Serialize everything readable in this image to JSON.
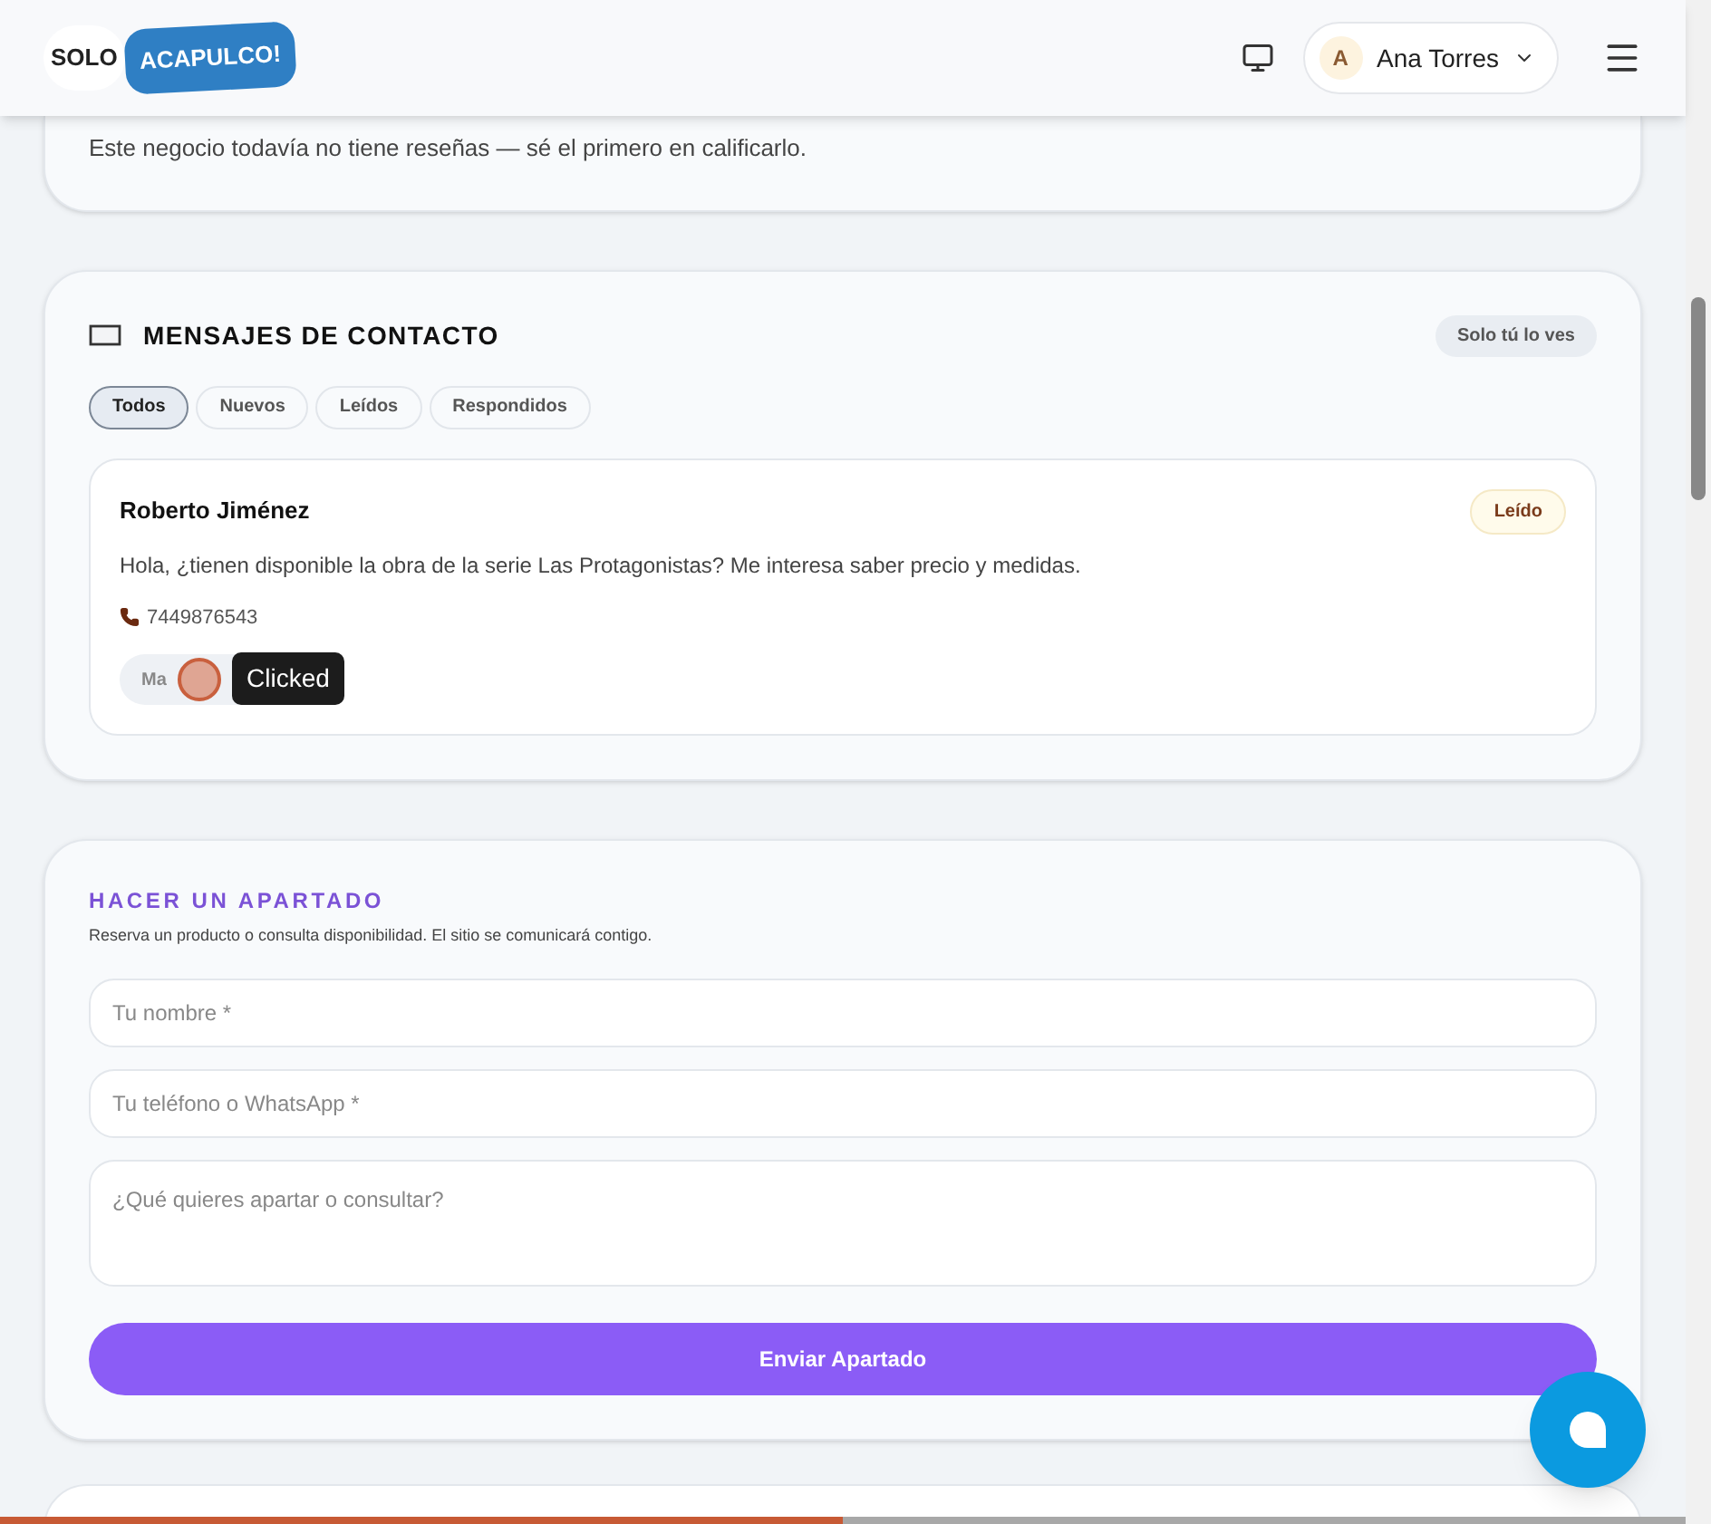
{
  "header": {
    "logo": [
      "SOLO",
      "ACAPULCO!"
    ],
    "user": {
      "initial": "A",
      "name": "Ana Torres"
    }
  },
  "reviews": {
    "empty_text": "Este negocio todavía no tiene reseñas — sé el primero en calificarlo."
  },
  "messages": {
    "title": "MENSAJES DE CONTACTO",
    "badge": "Solo tú lo ves",
    "filters": [
      {
        "label": "Todos",
        "selected": true
      },
      {
        "label": "Nuevos",
        "selected": false
      },
      {
        "label": "Leídos",
        "selected": false
      },
      {
        "label": "Respondidos",
        "selected": false
      }
    ],
    "items": [
      {
        "name": "Roberto Jiménez",
        "status": "Leído",
        "text": "Hola, ¿tienen disponible la obra de la serie Las Protagonistas? Me interesa saber precio y medidas.",
        "phone": "7449876543",
        "action": "Ma"
      }
    ]
  },
  "reservation": {
    "title": "HACER UN APARTADO",
    "subtitle": "Reserva un producto o consulta disponibilidad. El sitio se comunicará contigo.",
    "fields": [
      {
        "kind": "input",
        "placeholder": "Tu nombre *"
      },
      {
        "kind": "input",
        "placeholder": "Tu teléfono o WhatsApp *"
      },
      {
        "kind": "textarea",
        "placeholder": "¿Qué quieres apartar o consultar?"
      }
    ],
    "submit": "Enviar Apartado"
  },
  "click_tooltip": "Clicked",
  "progress": {
    "level": 0.5
  }
}
